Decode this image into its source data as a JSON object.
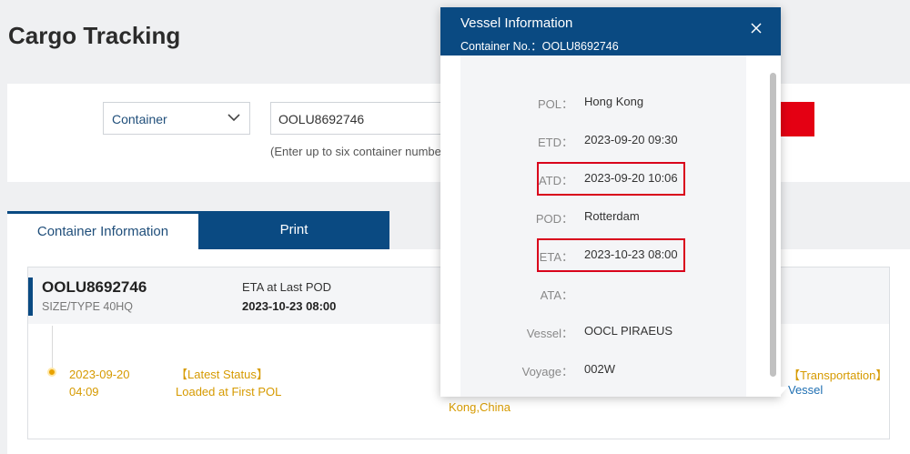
{
  "page": {
    "title": "Cargo Tracking"
  },
  "search": {
    "type_value": "Container",
    "input_value": "OOLU8692746",
    "hint": "(Enter up to six container numbers"
  },
  "tabs": [
    {
      "label": "Container Information",
      "active": true
    },
    {
      "label": "Print",
      "active": false
    }
  ],
  "container_card": {
    "id": "OOLU8692746",
    "size_type": "SIZE/TYPE 40HQ",
    "eta_label": "ETA at Last POD",
    "eta_value": "2023-10-23 08:00",
    "events": [
      {
        "date": "2023-09-20",
        "time": "04:09",
        "status_title": "【Latest Status】",
        "status_text": "Loaded at First POL",
        "location_tail": "Kong,China",
        "transport_title": "【Transportation】",
        "transport_value": "Vessel"
      }
    ]
  },
  "vessel_popup": {
    "title": "Vessel Information",
    "subtitle": "Container No.：OOLU8692746",
    "fields": [
      {
        "label": "POL：",
        "value": "Hong Kong",
        "highlighted": false
      },
      {
        "label": "ETD：",
        "value": "2023-09-20 09:30",
        "highlighted": false
      },
      {
        "label": "ATD：",
        "value": "2023-09-20 10:06",
        "highlighted": true
      },
      {
        "label": "POD：",
        "value": "Rotterdam",
        "highlighted": false
      },
      {
        "label": "ETA：",
        "value": "2023-10-23 08:00",
        "highlighted": true
      },
      {
        "label": "ATA：",
        "value": "",
        "highlighted": false
      },
      {
        "label": "Vessel：",
        "value": "OOCL PIRAEUS",
        "highlighted": false
      },
      {
        "label": "Voyage：",
        "value": "002W",
        "highlighted": false
      }
    ]
  },
  "colors": {
    "brand_blue": "#0a4a82",
    "search_red": "#e40013",
    "highlight_red": "#d9001b",
    "status_amber": "#d69a00",
    "link_blue": "#1f6fb2"
  },
  "icons": {
    "select": "chevron-down-icon",
    "search": "search-icon",
    "close": "close-icon",
    "timeline": "timeline-dot-icon"
  }
}
